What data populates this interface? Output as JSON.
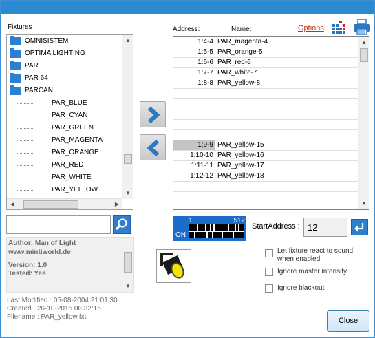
{
  "header": {
    "fixtures_label": "Fixtures",
    "address_label": "Address:",
    "name_label": "Name:",
    "options_link": "Options"
  },
  "tree": {
    "folders": [
      "OMNISISTEM",
      "OPTIMA LIGHTING",
      "PAR",
      "PAR 64",
      "PARCAN"
    ],
    "children": [
      "PAR_BLUE",
      "PAR_CYAN",
      "PAR_GREEN",
      "PAR_MAGENTA",
      "PAR_ORANGE",
      "PAR_RED",
      "PAR_WHITE",
      "PAR_YELLOW"
    ],
    "vertical_scroll_position": 0.82,
    "horizontal_scroll_position": 0.15
  },
  "address_table": {
    "rows": [
      {
        "address": "1:4-4",
        "name": "PAR_magenta-4"
      },
      {
        "address": "1:5-5",
        "name": "PAR_orange-5"
      },
      {
        "address": "1:6-6",
        "name": "PAR_red-6"
      },
      {
        "address": "1:7-7",
        "name": "PAR_white-7"
      },
      {
        "address": "1:8-8",
        "name": "PAR_yellow-8"
      },
      {
        "address": "",
        "name": ""
      },
      {
        "address": "",
        "name": ""
      },
      {
        "address": "",
        "name": ""
      },
      {
        "address": "",
        "name": ""
      },
      {
        "address": "",
        "name": ""
      },
      {
        "address": "1:9-9",
        "name": "PAR_yellow-15",
        "selected": true
      },
      {
        "address": "1:10-10",
        "name": "PAR_yellow-16"
      },
      {
        "address": "1:11-11",
        "name": "PAR_yellow-17"
      },
      {
        "address": "1:12-12",
        "name": "PAR_yellow-18"
      },
      {
        "address": "",
        "name": ""
      },
      {
        "address": "",
        "name": ""
      }
    ]
  },
  "search": {
    "value": ""
  },
  "fixture_info": {
    "author": "Author: Man of Light",
    "website": "www.mintiworld.de",
    "version": "Version: 1.0",
    "tested": "Tested: Yes"
  },
  "file_meta": {
    "last_modified": "Last Modified : 05-08-2004 21:01:30",
    "created": "Created : 26-10-2015 06:32:15",
    "filename": "Filename : PAR_yellow.fxt"
  },
  "dmx": {
    "start": "1",
    "end": "512",
    "on_label": "ON"
  },
  "start_address": {
    "label": "StartAddress :",
    "value": "12"
  },
  "options": {
    "react_to_sound": "Let fixture react to sound when enabled",
    "ignore_master": "Ignore master intensity",
    "ignore_blackout": "Ignore blackout"
  },
  "close_label": "Close",
  "colors": {
    "accent": "#2b8ad0",
    "folder": "#2d7fd3",
    "link": "#c03010",
    "arrow": "#2a78c8"
  }
}
